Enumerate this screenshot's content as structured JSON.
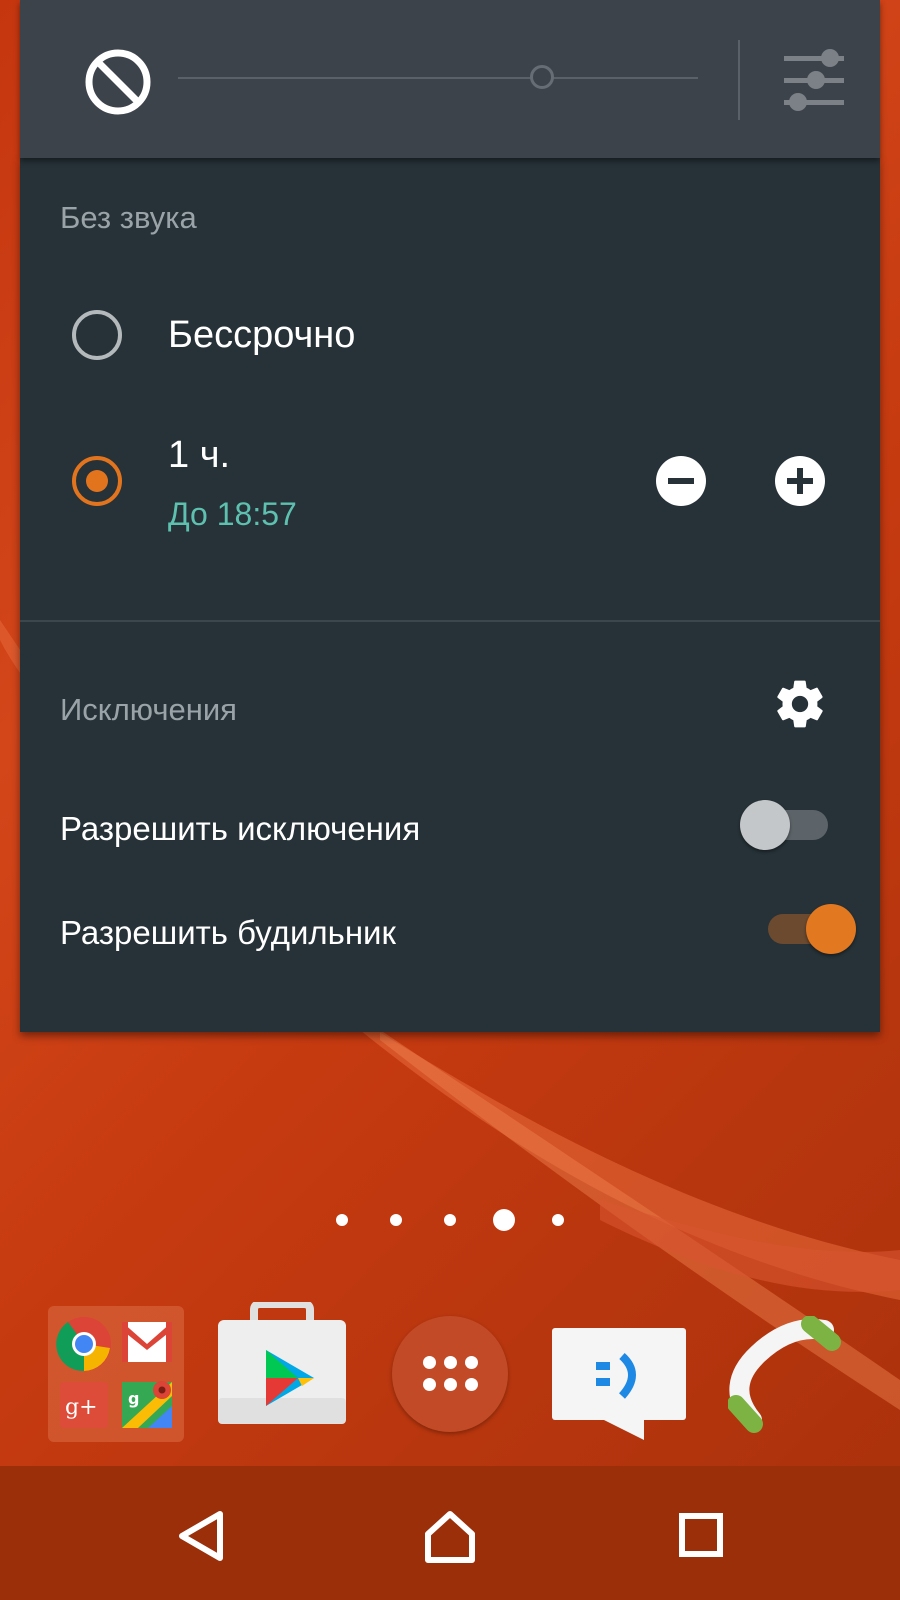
{
  "volume_panel": {
    "dnd_icon": "do-not-disturb-icon",
    "volume_level": 0.71,
    "settings_icon": "sliders-icon"
  },
  "zen_mode": {
    "title": "Без звука",
    "options": [
      {
        "label": "Бессрочно",
        "selected": false
      },
      {
        "label": "1 ч.",
        "sublabel": "До 18:57",
        "selected": true
      }
    ],
    "decrease_icon": "minus-circle-icon",
    "increase_icon": "plus-circle-icon"
  },
  "exceptions": {
    "title": "Исключения",
    "settings_icon": "gear-icon",
    "rows": [
      {
        "label": "Разрешить исключения",
        "enabled": false
      },
      {
        "label": "Разрешить будильник",
        "enabled": true
      }
    ]
  },
  "home": {
    "page_count": 5,
    "active_page": 4,
    "dock": [
      {
        "name": "google-apps-folder",
        "icons": [
          "chrome-icon",
          "gmail-icon",
          "google-plus-icon",
          "maps-icon"
        ]
      },
      {
        "name": "play-store-icon"
      },
      {
        "name": "app-drawer-icon"
      },
      {
        "name": "messaging-icon"
      },
      {
        "name": "phone-icon"
      }
    ]
  },
  "navigation": {
    "back_icon": "back-icon",
    "home_icon": "home-icon",
    "recents_icon": "recents-icon"
  },
  "colors": {
    "accent": "#e2741e",
    "panel_bg": "#263238",
    "volume_bg": "#3d434b",
    "time_text": "#5ec1b0",
    "wallpaper": "#c5360f"
  }
}
